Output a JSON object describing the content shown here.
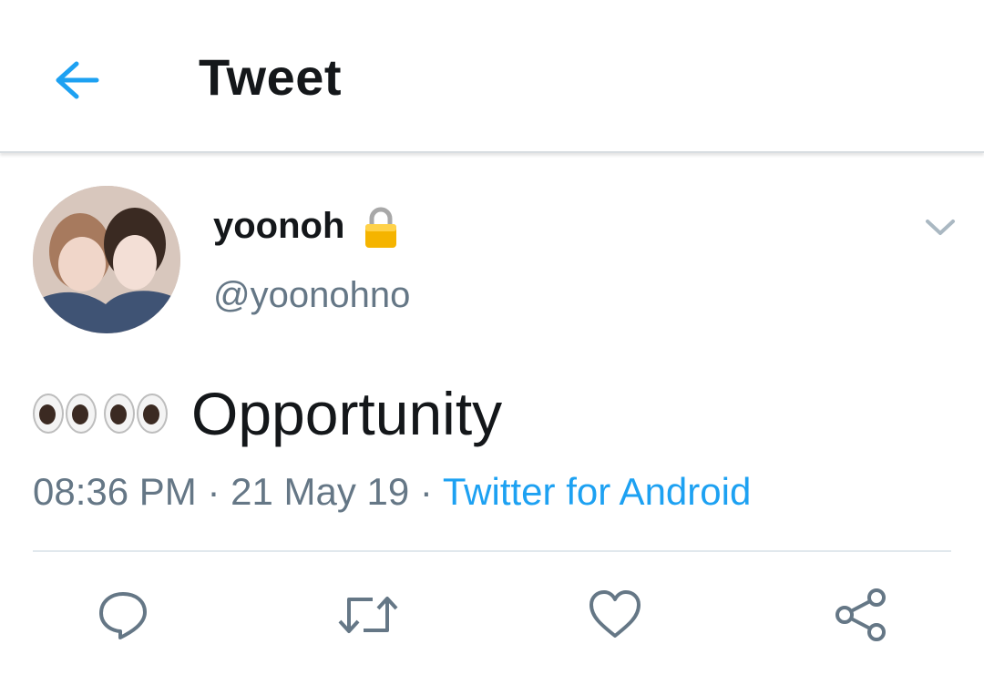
{
  "header": {
    "title": "Tweet",
    "back_icon": "arrow-left-icon",
    "accent": "#1da1f2"
  },
  "tweet": {
    "display_name": "yoonoh",
    "handle": "@yoonohno",
    "protected_icon": "lock-icon",
    "emoji": "eyes-emoji x2",
    "text": "Opportunity",
    "time": "08:36 PM",
    "date": "21 May 19",
    "separator": "·",
    "source": "Twitter for Android"
  },
  "actions": [
    {
      "name": "reply",
      "icon": "reply-icon"
    },
    {
      "name": "retweet",
      "icon": "retweet-icon"
    },
    {
      "name": "like",
      "icon": "heart-icon"
    },
    {
      "name": "share",
      "icon": "share-icon"
    }
  ],
  "colors": {
    "text_primary": "#14171a",
    "text_secondary": "#657786",
    "link": "#1da1f2",
    "icon_gray": "#657786"
  }
}
